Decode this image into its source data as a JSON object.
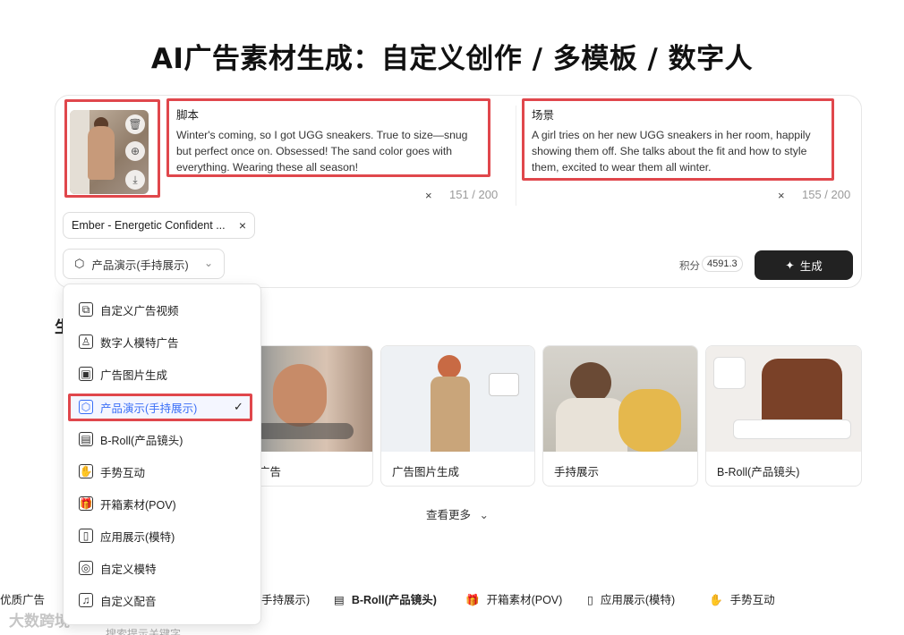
{
  "page": {
    "title": "AI广告素材生成：自定义创作 / 多模板 / 数字人"
  },
  "script": {
    "label": "脚本",
    "lines": [
      "Winter's coming, so I got UGG sneakers. True to size—snug",
      "but perfect once on. Obsessed! The sand color goes with",
      "everything. Wearing these all season!"
    ],
    "counter": "151 / 200",
    "clear": "×"
  },
  "scene": {
    "label": "场景",
    "lines": [
      "A girl tries on her new UGG sneakers in her room, happily",
      "showing them off. She talks about the fit and how to style",
      "them, excited to wear them all winter."
    ],
    "counter": "155 / 200",
    "clear": "×"
  },
  "voice_chip": {
    "label": "Ember - Energetic Confident ...",
    "close": "×"
  },
  "mode_select": {
    "value": "产品演示(手持展示)",
    "caret": "⌄"
  },
  "credits": {
    "label": "积分",
    "value": "4591.3"
  },
  "generate_button": {
    "label": "生成",
    "icon": "✦"
  },
  "section": {
    "heading": "生"
  },
  "tiles": [
    {
      "caption": "..模特广告"
    },
    {
      "caption": "广告图片生成"
    },
    {
      "caption": "手持展示"
    },
    {
      "caption": "B-Roll(产品镜头)"
    }
  ],
  "see_more": {
    "label": "查看更多",
    "icon": "⌄"
  },
  "menu": {
    "items": [
      {
        "label": "自定义广告视频",
        "icon": "⧉"
      },
      {
        "label": "数字人模特广告",
        "icon": "♙"
      },
      {
        "label": "广告图片生成",
        "icon": "▣"
      },
      {
        "label": "产品演示(手持展示)",
        "icon": "⬡",
        "selected": true
      },
      {
        "label": "B-Roll(产品镜头)",
        "icon": "▤"
      },
      {
        "label": "手势互动",
        "icon": "✋"
      },
      {
        "label": "开箱素材(POV)",
        "icon": "🎁"
      },
      {
        "label": "应用展示(模特)",
        "icon": "▯"
      },
      {
        "label": "自定义模特",
        "icon": "◎"
      },
      {
        "label": "自定义配音",
        "icon": "♫"
      }
    ],
    "check": "✓"
  },
  "bottom_tabs": [
    {
      "label": "优质广告"
    },
    {
      "label": "手持展示)"
    },
    {
      "label": "B-Roll(产品镜头)"
    },
    {
      "label": "开箱素材(POV)"
    },
    {
      "label": "应用展示(模特)"
    },
    {
      "label": "手势互动"
    }
  ],
  "watermark": {
    "text": "大数跨境"
  },
  "search": {
    "placeholder": "搜索提示关键字"
  },
  "colors": {
    "highlight": "#e0474c",
    "accent": "#3a6ff7",
    "button": "#222222"
  }
}
